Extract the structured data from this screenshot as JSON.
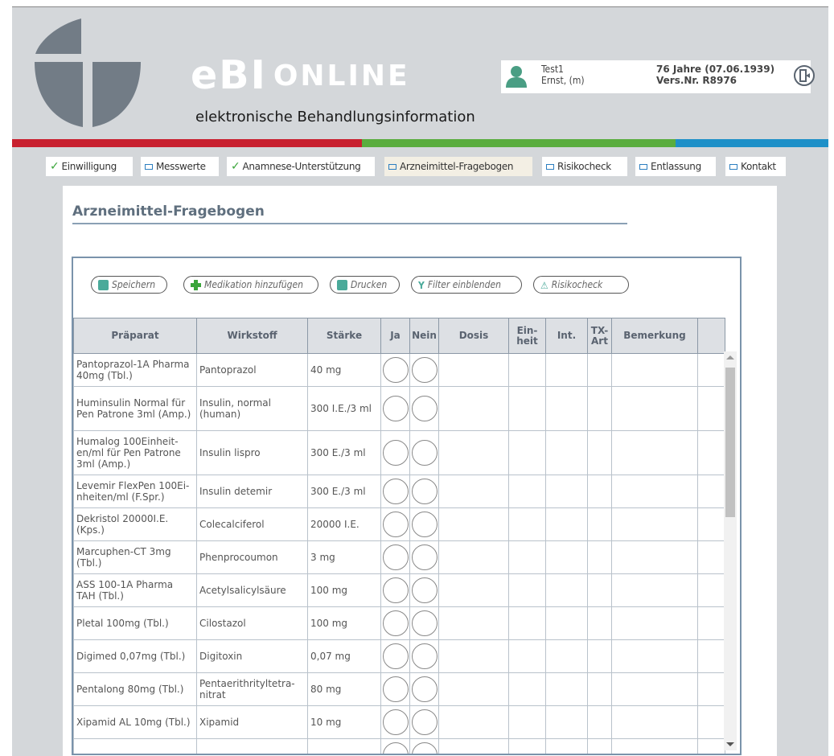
{
  "header": {
    "brand": "eBI",
    "brand_suffix": "ONLINE",
    "subtitle": "elektronische Behandlungsinformation",
    "colorbar": [
      "#c8202f",
      "#5aad3e",
      "#1e90c8"
    ]
  },
  "patient": {
    "id": "Test1",
    "name": "Ernst, (m)",
    "age": "76 Jahre (07.06.1939)",
    "insurance": "Vers.Nr. R8976",
    "icon": "person-icon"
  },
  "tabs": [
    {
      "label": "Einwilligung",
      "state": "done"
    },
    {
      "label": "Messwerte",
      "state": "open"
    },
    {
      "label": "Anamnese-Unterstützung",
      "state": "done"
    },
    {
      "label": "Arzneimittel-Fragebogen",
      "state": "active"
    },
    {
      "label": "Risikocheck",
      "state": "open"
    },
    {
      "label": "Entlassung",
      "state": "open"
    },
    {
      "label": "Kontakt",
      "state": "open"
    }
  ],
  "page": {
    "title": "Arzneimittel-Fragebogen"
  },
  "toolbar": {
    "save": "Speichern",
    "add": "Medikation hinzufügen",
    "print": "Drucken",
    "filter": "Filter einblenden",
    "risk": "Risikocheck"
  },
  "table": {
    "headers": [
      "Präparat",
      "Wirkstoff",
      "Stärke",
      "Ja",
      "Nein",
      "Dosis",
      "Ein-\nheit",
      "Int.",
      "TX-\nArt",
      "Bemerkung",
      ""
    ],
    "rows": [
      {
        "praeparat": "Pantoprazol-1A Pharma 40mg (Tbl.)",
        "wirkstoff": "Pantoprazol",
        "staerke": "40 mg"
      },
      {
        "praeparat": "Huminsulin Normal für Pen Patrone 3ml (Amp.)",
        "wirkstoff": "Insulin, normal (human)",
        "staerke": "300 I.E./3 ml"
      },
      {
        "praeparat": "Humalog 100Einheit-en/ml für Pen Patrone 3ml (Amp.)",
        "wirkstoff": "Insulin lispro",
        "staerke": "300 E./3 ml"
      },
      {
        "praeparat": "Levemir FlexPen 100Ei-nheiten/ml (F.Spr.)",
        "wirkstoff": "Insulin detemir",
        "staerke": "300 E./3 ml"
      },
      {
        "praeparat": "Dekristol 20000I.E. (Kps.)",
        "wirkstoff": "Colecalciferol",
        "staerke": "20000 I.E."
      },
      {
        "praeparat": "Marcuphen-CT 3mg (Tbl.)",
        "wirkstoff": "Phenprocoumon",
        "staerke": "3 mg"
      },
      {
        "praeparat": "ASS 100-1A Pharma TAH (Tbl.)",
        "wirkstoff": "Acetylsalicylsäure",
        "staerke": "100 mg"
      },
      {
        "praeparat": "Pletal 100mg (Tbl.)",
        "wirkstoff": "Cilostazol",
        "staerke": "100 mg"
      },
      {
        "praeparat": "Digimed 0,07mg (Tbl.)",
        "wirkstoff": "Digitoxin",
        "staerke": "0,07 mg"
      },
      {
        "praeparat": "Pentalong 80mg (Tbl.)",
        "wirkstoff": "Pentaerithrityltetra-nitrat",
        "staerke": "80 mg"
      },
      {
        "praeparat": "Xipamid AL 10mg (Tbl.)",
        "wirkstoff": "Xipamid",
        "staerke": "10 mg"
      },
      {
        "praeparat": "",
        "wirkstoff": "",
        "staerke": ""
      }
    ]
  }
}
